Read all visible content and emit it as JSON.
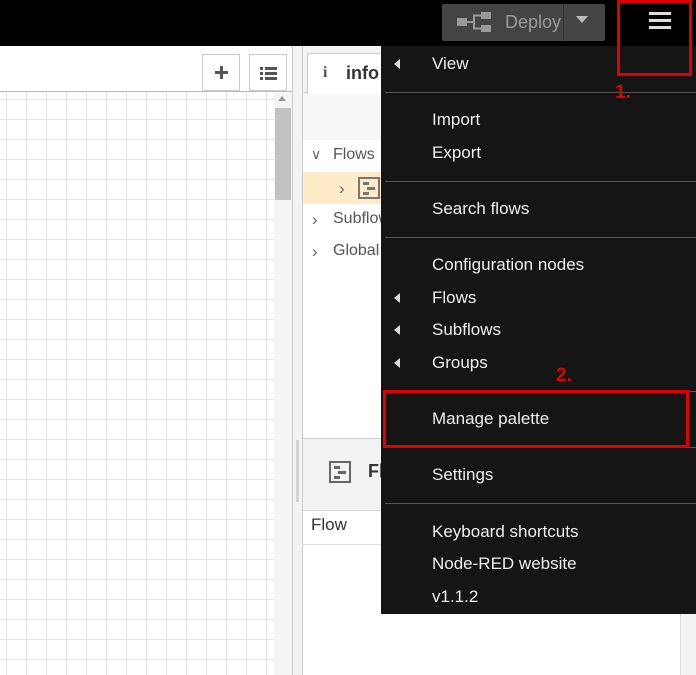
{
  "header": {
    "deploy_label": "Deploy"
  },
  "workspace": {
    "add_tab_label": "+"
  },
  "sidebar": {
    "tab_icon": "i",
    "tab_label": "info",
    "tree": [
      {
        "label": "Flows",
        "chevron": "∨"
      },
      {
        "label": "",
        "chevron": "›"
      },
      {
        "label": "Subflows",
        "chevron": "›"
      },
      {
        "label": "Global",
        "chevron": "›"
      }
    ],
    "lower_title": "Fl",
    "flow_table_label": "Flow"
  },
  "menu": {
    "items": [
      {
        "label": "View",
        "has_submenu": true
      },
      {
        "label": "Import",
        "has_submenu": false
      },
      {
        "label": "Export",
        "has_submenu": false
      },
      {
        "label": "Search flows",
        "has_submenu": false
      },
      {
        "label": "Configuration nodes",
        "has_submenu": false
      },
      {
        "label": "Flows",
        "has_submenu": true
      },
      {
        "label": "Subflows",
        "has_submenu": true
      },
      {
        "label": "Groups",
        "has_submenu": true
      },
      {
        "label": "Manage palette",
        "has_submenu": false
      },
      {
        "label": "Settings",
        "has_submenu": false
      },
      {
        "label": "Keyboard shortcuts",
        "has_submenu": false
      },
      {
        "label": "Node-RED website",
        "has_submenu": false
      },
      {
        "label": "v1.1.2",
        "has_submenu": false
      }
    ]
  },
  "annotations": {
    "step1": "1.",
    "step2": "2.",
    "color": "#e00000"
  }
}
